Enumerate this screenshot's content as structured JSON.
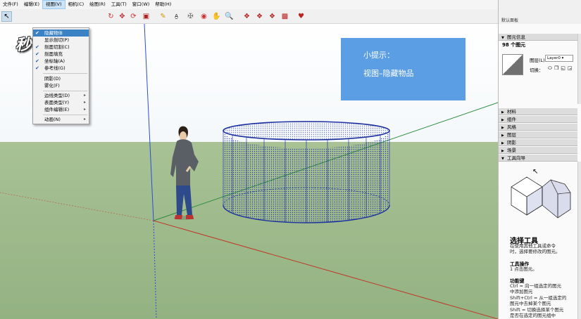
{
  "menubar": {
    "items": [
      {
        "label": "文件(F)",
        "active": false
      },
      {
        "label": "编辑(E)",
        "active": false
      },
      {
        "label": "视图(V)",
        "active": true
      },
      {
        "label": "相机(C)",
        "active": false
      },
      {
        "label": "绘图(R)",
        "active": false
      },
      {
        "label": "工具(T)",
        "active": false
      },
      {
        "label": "窗口(W)",
        "active": false
      },
      {
        "label": "帮助(H)",
        "active": false
      }
    ]
  },
  "watermark": {
    "text": "秒懂视频"
  },
  "tip": {
    "title": "小提示：",
    "body": "视图–隐藏物品"
  },
  "view_menu": {
    "items": [
      {
        "label": "隐藏物体",
        "checked": true,
        "highlighted": true,
        "submenu": false
      },
      {
        "label": "显示剖切(P)",
        "checked": false,
        "highlighted": false,
        "submenu": false
      },
      {
        "label": "剖面切割(C)",
        "checked": true,
        "highlighted": false,
        "submenu": false
      },
      {
        "label": "剖面填充",
        "checked": true,
        "highlighted": false,
        "submenu": false
      },
      {
        "label": "坐标轴(A)",
        "checked": true,
        "highlighted": false,
        "submenu": false
      },
      {
        "label": "参考线(G)",
        "checked": true,
        "highlighted": false,
        "submenu": false
      },
      {
        "label": "阴影(D)",
        "checked": false,
        "highlighted": false,
        "submenu": false
      },
      {
        "label": "雾化(F)",
        "checked": false,
        "highlighted": false,
        "submenu": false
      },
      {
        "label": "边线类型(D)",
        "checked": false,
        "highlighted": false,
        "submenu": true
      },
      {
        "label": "表面类型(Y)",
        "checked": false,
        "highlighted": false,
        "submenu": true
      },
      {
        "label": "组件编辑(E)",
        "checked": false,
        "highlighted": false,
        "submenu": true
      },
      {
        "label": "动画(N)",
        "checked": false,
        "highlighted": false,
        "submenu": true
      }
    ]
  },
  "panel": {
    "title": "默认面板",
    "entity_info": {
      "header": "图元信息",
      "count": "98 个图元",
      "layer_label": "图层(L):",
      "layer_value": "Layer0",
      "toggle_label": "切换："
    },
    "sections": [
      {
        "label": "材料",
        "expanded": false
      },
      {
        "label": "组件",
        "expanded": false
      },
      {
        "label": "风格",
        "expanded": false
      },
      {
        "label": "图层",
        "expanded": false
      },
      {
        "label": "阴影",
        "expanded": false
      },
      {
        "label": "场景",
        "expanded": false
      },
      {
        "label": "工具向导",
        "expanded": true
      }
    ],
    "guide": {
      "title": "选择工具",
      "desc_1": "在使用其他工具或命令",
      "desc_2": "时，选择要修改的图元。",
      "ops_title": "工具操作",
      "ops_1": "1 点击图元。",
      "keys_title": "功能键",
      "keys_1": "Ctrl = 向一组选定的图元",
      "keys_2": "中添加图元",
      "keys_3": "Shift+Ctrl = 从一组选定的",
      "keys_4": "图元中去掉某个图元",
      "keys_5": "Shift = 切换选择某个图元",
      "keys_6": "是否在选定的图元组中"
    }
  },
  "colors": {
    "tip_bg": "#5b9ee3",
    "ground": "#93b282",
    "mesh": "#1c2f9e",
    "axis_red": "#c0392b",
    "axis_green": "#2e8b3d",
    "axis_blue": "#2a4fd4",
    "menu_highlight": "#3b82c4"
  }
}
